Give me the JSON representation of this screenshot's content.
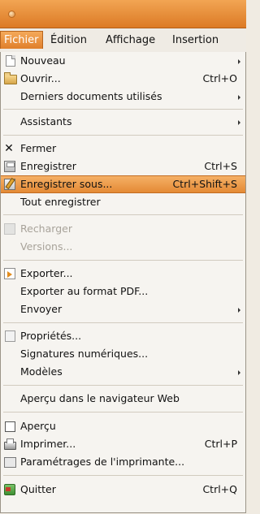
{
  "menubar": {
    "items": [
      {
        "label": "Fichier",
        "active": true
      },
      {
        "label": "Édition"
      },
      {
        "label": "Affichage"
      },
      {
        "label": "Insertion"
      }
    ]
  },
  "menu": {
    "items": [
      {
        "label": "Nouveau",
        "icon": "new-document-icon",
        "submenu": true
      },
      {
        "label": "Ouvrir...",
        "icon": "open-folder-icon",
        "shortcut": "Ctrl+O"
      },
      {
        "label": "Derniers documents utilisés",
        "submenu": true
      },
      {
        "label": "Assistants",
        "submenu": true
      },
      {
        "label": "Fermer",
        "icon": "close-icon"
      },
      {
        "label": "Enregistrer",
        "icon": "save-icon",
        "shortcut": "Ctrl+S"
      },
      {
        "label": "Enregistrer sous...",
        "icon": "save-as-icon",
        "shortcut": "Ctrl+Shift+S",
        "highlighted": true
      },
      {
        "label": "Tout enregistrer"
      },
      {
        "label": "Recharger",
        "icon": "reload-icon",
        "disabled": true
      },
      {
        "label": "Versions...",
        "disabled": true
      },
      {
        "label": "Exporter...",
        "icon": "export-icon"
      },
      {
        "label": "Exporter au format PDF..."
      },
      {
        "label": "Envoyer",
        "submenu": true
      },
      {
        "label": "Propriétés...",
        "icon": "properties-icon"
      },
      {
        "label": "Signatures numériques..."
      },
      {
        "label": "Modèles",
        "submenu": true
      },
      {
        "label": "Aperçu dans le navigateur Web"
      },
      {
        "label": "Aperçu",
        "icon": "checkbox-icon"
      },
      {
        "label": "Imprimer...",
        "icon": "printer-icon",
        "shortcut": "Ctrl+P"
      },
      {
        "label": "Paramétrages de l'imprimante...",
        "icon": "printer-settings-icon"
      },
      {
        "label": "Quitter",
        "icon": "quit-icon",
        "shortcut": "Ctrl+Q"
      }
    ]
  },
  "colors": {
    "accent": "#e48a35",
    "menu_bg": "#f6f4f0",
    "titlebar": "#dc7a25"
  }
}
